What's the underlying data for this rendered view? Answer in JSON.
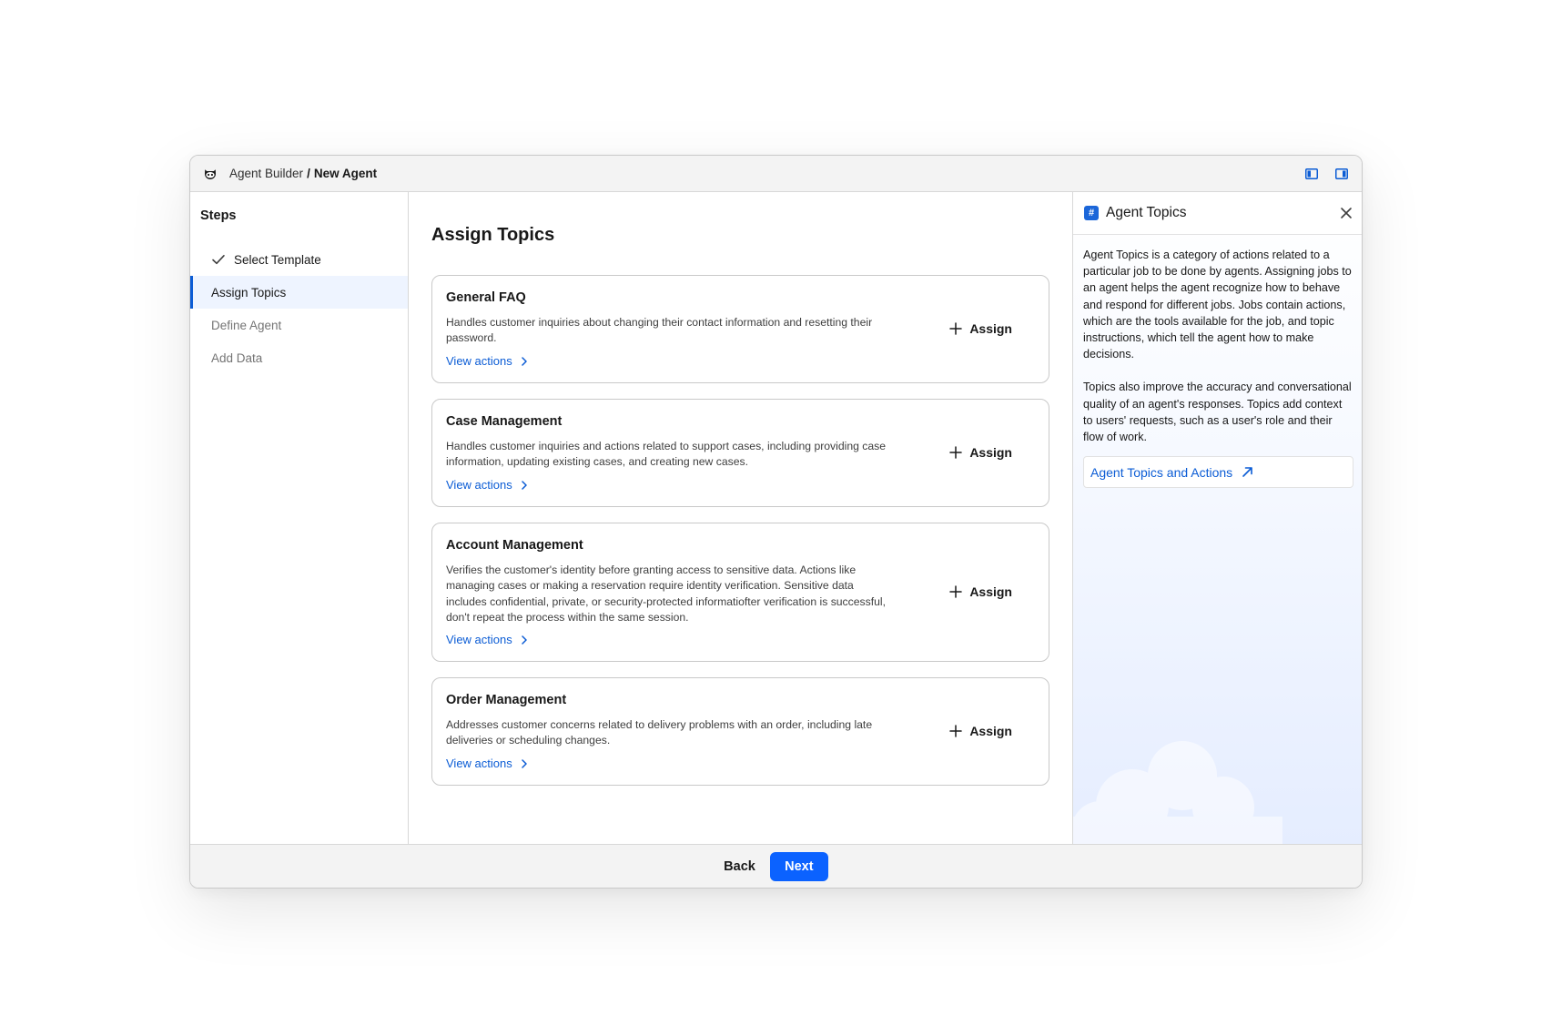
{
  "titlebar": {
    "app_name": "Agent Builder",
    "separator": "/",
    "current": "New Agent",
    "logo_icon": "agent-astro-icon",
    "icons": [
      "left-panel-toggle-icon",
      "right-panel-toggle-icon"
    ]
  },
  "steps": {
    "title": "Steps",
    "items": [
      {
        "label": "Select Template",
        "state": "done"
      },
      {
        "label": "Assign Topics",
        "state": "active"
      },
      {
        "label": "Define Agent",
        "state": "todo"
      },
      {
        "label": "Add Data",
        "state": "todo"
      }
    ]
  },
  "main": {
    "title": "Assign Topics",
    "view_actions_label": "View actions",
    "assign_label": "Assign",
    "topics": [
      {
        "title": "General FAQ",
        "description": "Handles customer inquiries about changing their contact information and resetting their password."
      },
      {
        "title": "Case Management",
        "description": "Handles customer inquiries and actions related to support cases, including providing case information, updating existing cases, and creating new cases."
      },
      {
        "title": "Account Management",
        "description": "Verifies the customer's identity before granting access to sensitive data. Actions like managing cases or making a reservation require identity verification. Sensitive data includes confidential, private, or security-protected informatiofter verification is successful, don't repeat the process within the same session."
      },
      {
        "title": "Order Management",
        "description": "Addresses customer concerns related to delivery problems with an order, including late deliveries or scheduling changes."
      }
    ]
  },
  "panel": {
    "title": "Agent Topics",
    "icon": "hash-icon",
    "paragraph_1": "Agent Topics is a category of actions related to a particular job to be done by agents. Assigning jobs to an agent helps the agent recognize how to behave and respond for different jobs. Jobs contain actions, which are the tools available for the job, and topic instructions, which tell the agent how to make decisions.",
    "paragraph_2": "Topics also improve the accuracy and conversational quality of an agent's responses. Topics add context to users' requests, such as a user's role and their flow of work.",
    "link_label": "Agent Topics and Actions"
  },
  "footer": {
    "back_label": "Back",
    "next_label": "Next"
  },
  "colors": {
    "accent": "#0b62ff",
    "link": "#0b5cd5",
    "active_step_bg": "#eef4ff"
  }
}
